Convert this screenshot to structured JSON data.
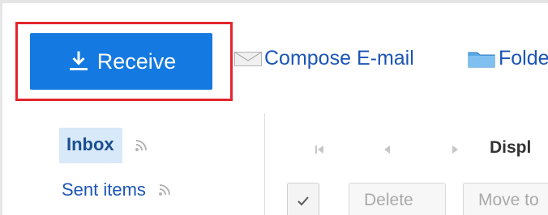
{
  "toolbar": {
    "receive_label": "Receive",
    "compose_label": "Compose E-mail",
    "folder_label": "Folde"
  },
  "sidebar": {
    "items": [
      {
        "label": "Inbox",
        "selected": true
      },
      {
        "label": "Sent items",
        "selected": false
      }
    ]
  },
  "message_list": {
    "display_label": "Displ",
    "actions": {
      "delete_label": "Delete",
      "move_label": "Move to"
    }
  },
  "colors": {
    "primary_button": "#1479e0",
    "link": "#1b55b7",
    "highlight_border": "#e3252d",
    "selected_bg": "#d8e9f9"
  },
  "icons": {
    "receive": "download-icon",
    "compose": "envelope-icon",
    "folder": "folder-icon",
    "rss": "rss-icon",
    "pager_first": "first-page-icon",
    "pager_prev": "previous-page-icon",
    "pager_next": "next-page-icon",
    "check": "checkmark-icon"
  }
}
